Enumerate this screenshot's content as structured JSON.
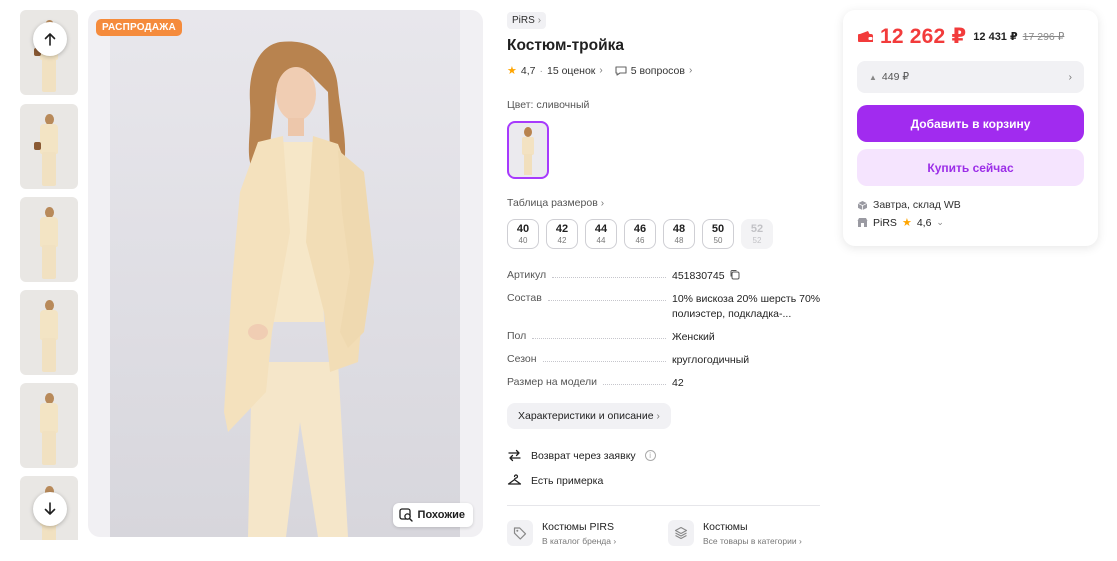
{
  "gallery": {
    "thumbnail_count": 6,
    "sale_badge": "РАСПРОДАЖА",
    "similar_label": "Похожие"
  },
  "product": {
    "brand": "PiRS",
    "title": "Костюм-тройка",
    "rating": "4,7",
    "reviews": "15 оценок",
    "questions": "5 вопросов",
    "color_label": "Цвет: сливочный",
    "size_table_label": "Таблица размеров",
    "sizes": [
      {
        "size": "40",
        "ru": "40",
        "available": true
      },
      {
        "size": "42",
        "ru": "42",
        "available": true
      },
      {
        "size": "44",
        "ru": "44",
        "available": true
      },
      {
        "size": "46",
        "ru": "46",
        "available": true
      },
      {
        "size": "48",
        "ru": "48",
        "available": true
      },
      {
        "size": "50",
        "ru": "50",
        "available": true
      },
      {
        "size": "52",
        "ru": "52",
        "available": false
      }
    ],
    "specs": [
      {
        "key": "Артикул",
        "value": "451830745"
      },
      {
        "key": "Состав",
        "value": "10% вискоза 20% шерсть 70% полиэстер, подкладка-..."
      },
      {
        "key": "Пол",
        "value": "Женский"
      },
      {
        "key": "Сезон",
        "value": "круглогодичный"
      },
      {
        "key": "Размер на модели",
        "value": "42"
      }
    ],
    "description_button": "Характеристики и описание",
    "features": [
      {
        "icon": "return-arrows-icon",
        "label": "Возврат через заявку"
      },
      {
        "icon": "hanger-icon",
        "label": "Есть примерка"
      }
    ],
    "links": [
      {
        "icon": "tag-icon",
        "title": "Костюмы PIRS",
        "subtitle": "В каталог бренда"
      },
      {
        "icon": "stack-icon",
        "title": "Костюмы",
        "subtitle": "Все товары в категории"
      }
    ]
  },
  "price_card": {
    "price_wallet": "12 262 ₽",
    "price_card": "12 431 ₽",
    "price_old": "17 296 ₽",
    "installment": "449 ₽",
    "add_to_cart": "Добавить в корзину",
    "buy_now": "Купить сейчас",
    "delivery": "Завтра, склад WB",
    "seller": "PiRS",
    "seller_rating": "4,6"
  },
  "colors": {
    "accent": "#a12bef",
    "price_red": "#f23b3b",
    "sale_orange": "#f58b3c",
    "star": "#ffa500"
  }
}
